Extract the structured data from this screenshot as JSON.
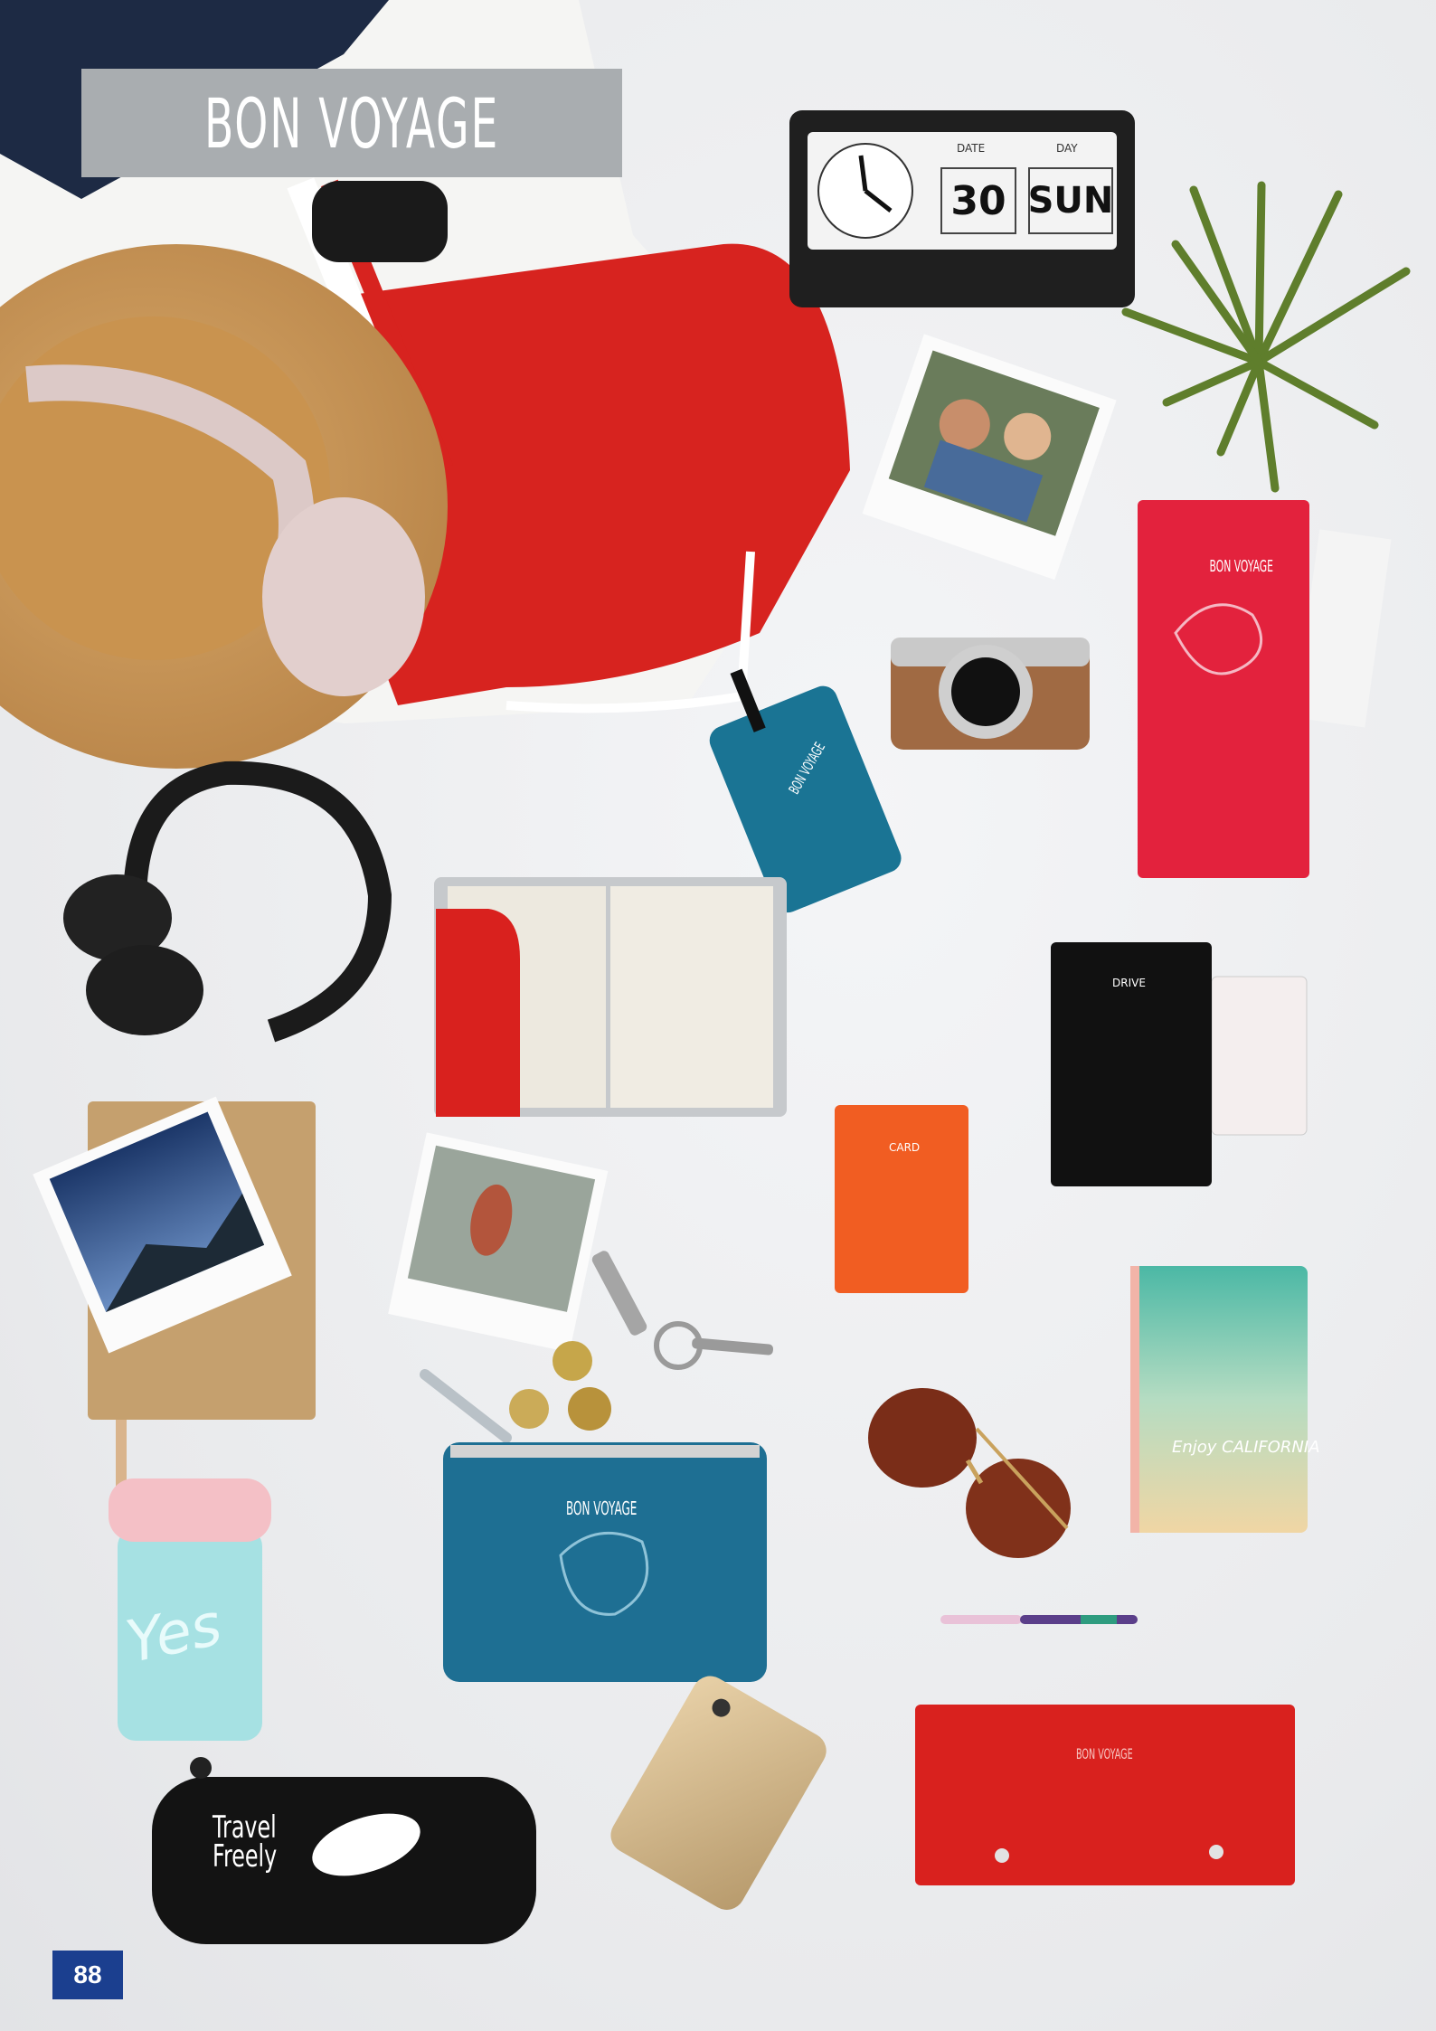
{
  "header": {
    "title": "BON VOYAGE"
  },
  "clock": {
    "date_label": "DATE",
    "day_label": "DAY",
    "date_value": "30",
    "day_value": "SUN"
  },
  "products": {
    "red_travel_wallet_label": "BON VOYAGE",
    "luggage_tag_label": "BON VOYAGE",
    "drive_wallet_label": "DRIVE",
    "card_holder_label": "CARD",
    "pouch_label": "BON VOYAGE",
    "red_doc_wallet_label": "BON VOYAGE",
    "notebook_label": "Enjoy CALIFORNIA",
    "cup_label": "Yes",
    "pencil_case_label": "Travel Freely"
  },
  "footer": {
    "page_number": "88"
  }
}
